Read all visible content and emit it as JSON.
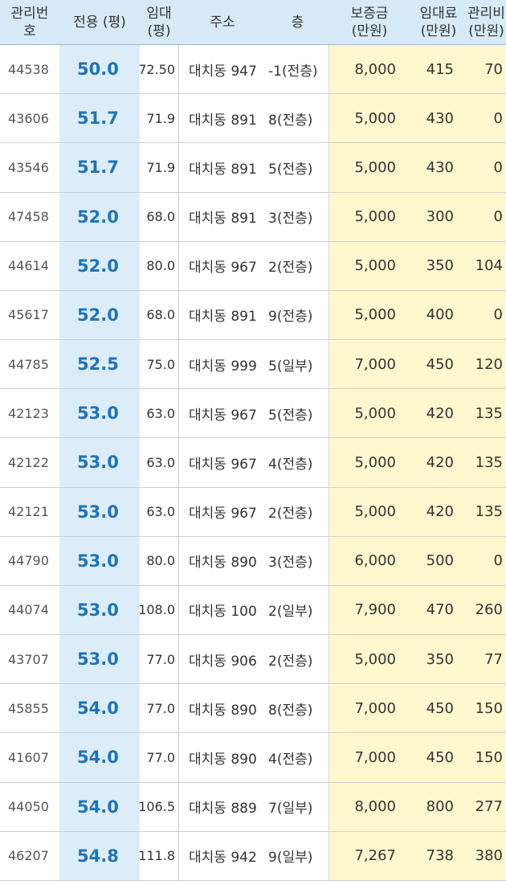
{
  "headers": {
    "id": [
      "관리번",
      "호"
    ],
    "area": [
      "전용 (평)"
    ],
    "lease": [
      "임대",
      "(평)"
    ],
    "address": [
      "주소"
    ],
    "floor": [
      "층"
    ],
    "deposit": [
      "보증금",
      "(만원)"
    ],
    "rent": [
      "임대료",
      "(만원)"
    ],
    "fee": [
      "관리비",
      "(만원)"
    ]
  },
  "colors": {
    "header_bg": "#d7eaf7",
    "area_bg": "#dcedf9",
    "area_text": "#1f73b7",
    "money_bg": "#fff8cf"
  },
  "rows": [
    {
      "id": "44538",
      "area": "50.0",
      "lease": "72.50",
      "address": "대치동 947",
      "floor": "-1(전층)",
      "deposit": "8,000",
      "rent": "415",
      "fee": "70"
    },
    {
      "id": "43606",
      "area": "51.7",
      "lease": "71.9",
      "address": "대치동 891",
      "floor": "8(전층)",
      "deposit": "5,000",
      "rent": "430",
      "fee": "0"
    },
    {
      "id": "43546",
      "area": "51.7",
      "lease": "71.9",
      "address": "대치동 891",
      "floor": "5(전층)",
      "deposit": "5,000",
      "rent": "430",
      "fee": "0"
    },
    {
      "id": "47458",
      "area": "52.0",
      "lease": "68.0",
      "address": "대치동 891",
      "floor": "3(전층)",
      "deposit": "5,000",
      "rent": "300",
      "fee": "0"
    },
    {
      "id": "44614",
      "area": "52.0",
      "lease": "80.0",
      "address": "대치동 967",
      "floor": "2(전층)",
      "deposit": "5,000",
      "rent": "350",
      "fee": "104"
    },
    {
      "id": "45617",
      "area": "52.0",
      "lease": "68.0",
      "address": "대치동 891",
      "floor": "9(전층)",
      "deposit": "5,000",
      "rent": "400",
      "fee": "0"
    },
    {
      "id": "44785",
      "area": "52.5",
      "lease": "75.0",
      "address": "대치동 999",
      "floor": "5(일부)",
      "deposit": "7,000",
      "rent": "450",
      "fee": "120"
    },
    {
      "id": "42123",
      "area": "53.0",
      "lease": "63.0",
      "address": "대치동 967",
      "floor": "5(전층)",
      "deposit": "5,000",
      "rent": "420",
      "fee": "135"
    },
    {
      "id": "42122",
      "area": "53.0",
      "lease": "63.0",
      "address": "대치동 967",
      "floor": "4(전층)",
      "deposit": "5,000",
      "rent": "420",
      "fee": "135"
    },
    {
      "id": "42121",
      "area": "53.0",
      "lease": "63.0",
      "address": "대치동 967",
      "floor": "2(전층)",
      "deposit": "5,000",
      "rent": "420",
      "fee": "135"
    },
    {
      "id": "44790",
      "area": "53.0",
      "lease": "80.0",
      "address": "대치동 890",
      "floor": "3(전층)",
      "deposit": "6,000",
      "rent": "500",
      "fee": "0"
    },
    {
      "id": "44074",
      "area": "53.0",
      "lease": "108.0",
      "address": "대치동 100",
      "floor": "2(일부)",
      "deposit": "7,900",
      "rent": "470",
      "fee": "260"
    },
    {
      "id": "43707",
      "area": "53.0",
      "lease": "77.0",
      "address": "대치동 906",
      "floor": "2(전층)",
      "deposit": "5,000",
      "rent": "350",
      "fee": "77"
    },
    {
      "id": "45855",
      "area": "54.0",
      "lease": "77.0",
      "address": "대치동 890",
      "floor": "8(전층)",
      "deposit": "7,000",
      "rent": "450",
      "fee": "150"
    },
    {
      "id": "41607",
      "area": "54.0",
      "lease": "77.0",
      "address": "대치동 890",
      "floor": "4(전층)",
      "deposit": "7,000",
      "rent": "450",
      "fee": "150"
    },
    {
      "id": "44050",
      "area": "54.0",
      "lease": "106.5",
      "address": "대치동 889",
      "floor": "7(일부)",
      "deposit": "8,000",
      "rent": "800",
      "fee": "277"
    },
    {
      "id": "46207",
      "area": "54.8",
      "lease": "111.8",
      "address": "대치동 942",
      "floor": "9(일부)",
      "deposit": "7,267",
      "rent": "738",
      "fee": "380"
    }
  ]
}
